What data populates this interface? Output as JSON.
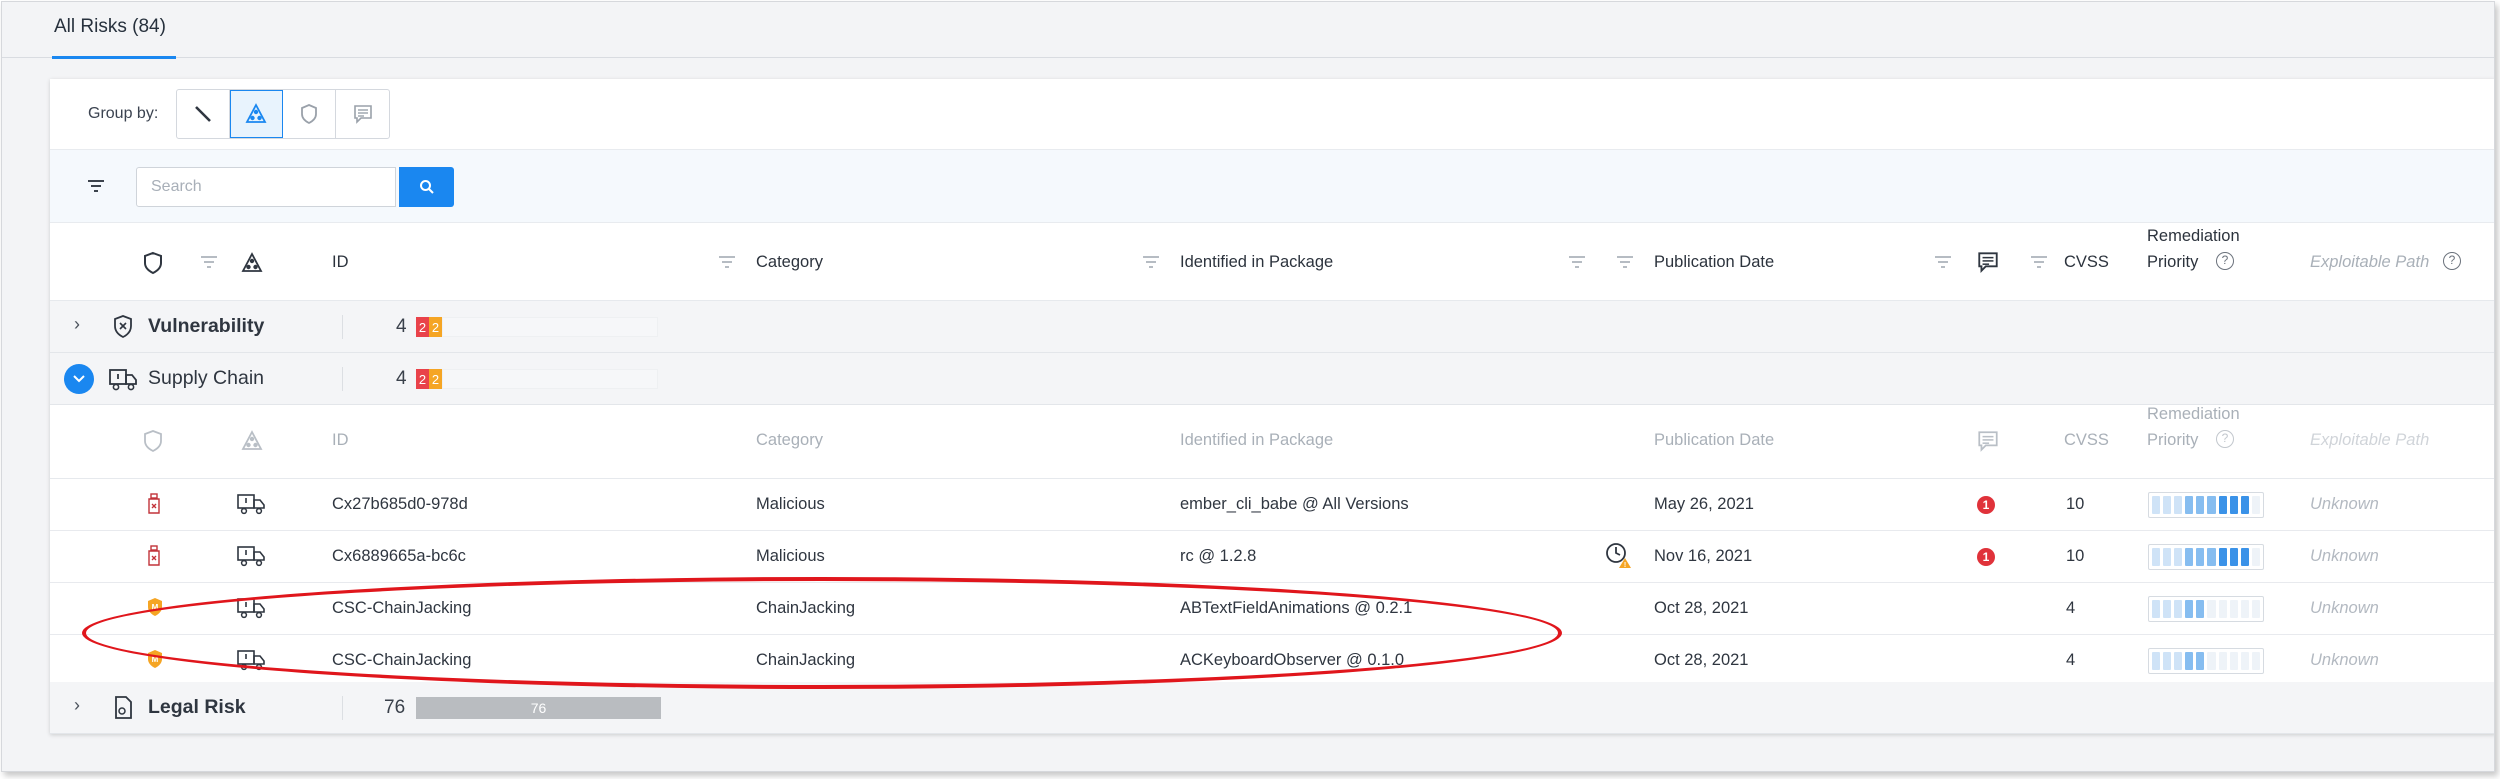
{
  "tab": {
    "label": "All Risks (84)"
  },
  "group_by": {
    "label": "Group by:"
  },
  "search": {
    "placeholder": "Search"
  },
  "columns": {
    "id": "ID",
    "category": "Category",
    "package": "Identified in Package",
    "publication_date": "Publication Date",
    "cvss": "CVSS",
    "remediation_line1": "Remediation",
    "remediation_line2": "Priority",
    "exploitable": "Exploitable Path"
  },
  "groups": [
    {
      "name": "Vulnerability",
      "count": "4",
      "red": "2",
      "orange": "2"
    },
    {
      "name": "Supply Chain",
      "count": "4",
      "red": "2",
      "orange": "2"
    },
    {
      "name": "Legal Risk",
      "count": "76",
      "bar": "76"
    }
  ],
  "rows": [
    {
      "id": "Cx27b685d0-978d",
      "category": "Malicious",
      "package": "ember_cli_babe @ All Versions",
      "date": "May 26, 2021",
      "comments": "1",
      "cvss": "10",
      "priority_level": 0.9,
      "exploitable": "Unknown"
    },
    {
      "id": "Cx6889665a-bc6c",
      "category": "Malicious",
      "package": "rc @ 1.2.8",
      "date": "Nov 16, 2021",
      "comments": "1",
      "cvss": "10",
      "priority_level": 0.9,
      "exploitable": "Unknown"
    },
    {
      "id": "CSC-ChainJacking",
      "category": "ChainJacking",
      "package": "ABTextFieldAnimations @ 0.2.1",
      "date": "Oct 28, 2021",
      "comments": "",
      "cvss": "4",
      "priority_level": 0.5,
      "exploitable": "Unknown"
    },
    {
      "id": "CSC-ChainJacking",
      "category": "ChainJacking",
      "package": "ACKeyboardObserver @ 0.1.0",
      "date": "Oct 28, 2021",
      "comments": "",
      "cvss": "4",
      "priority_level": 0.5,
      "exploitable": "Unknown"
    }
  ],
  "colors": {
    "accent": "#1a87f0",
    "critical": "#e9424a",
    "high": "#f5a524",
    "annotation": "#e0161c"
  }
}
